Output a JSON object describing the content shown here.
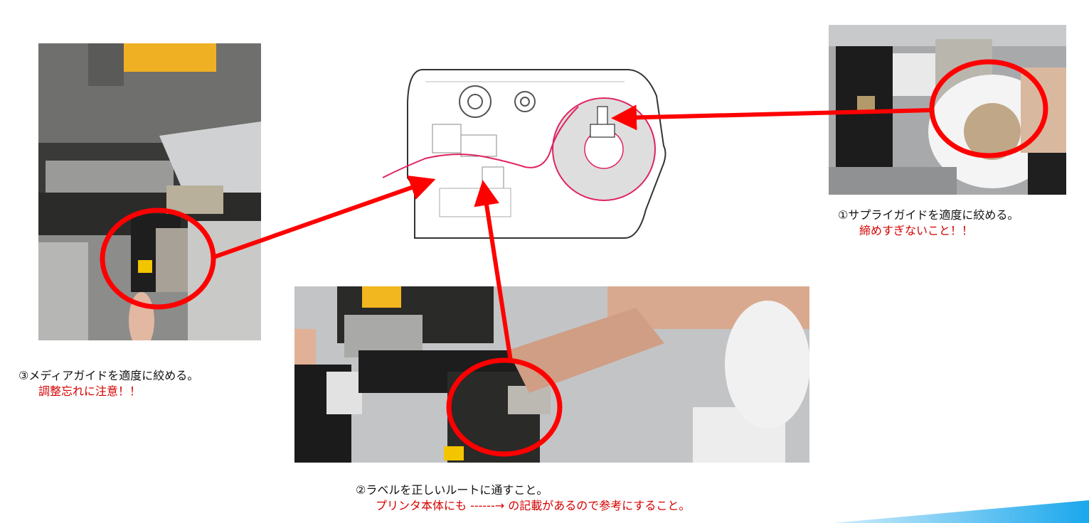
{
  "steps": {
    "step1": {
      "title": "①サプライガイドを適度に絞める。",
      "note": "締めすぎないこと！！"
    },
    "step2": {
      "title": "②ラベルを正しいルートに通すこと。",
      "note": "プリンタ本体にも ------→ の記載があるので参考にすること。"
    },
    "step3": {
      "title": "③メディアガイドを適度に絞める。",
      "note": "調整忘れに注意！！"
    }
  },
  "colors": {
    "annotation_red": "#ff0000",
    "label_path": "#e0245e",
    "note_text": "#d40000",
    "accent": "#1aa7ec"
  }
}
